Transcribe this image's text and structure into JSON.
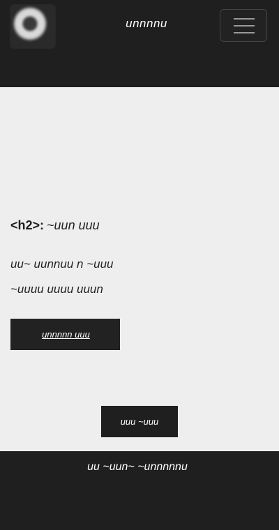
{
  "header": {
    "site_title": "unnnnu",
    "logo_icon": "circle-logo-icon",
    "menu_icon": "hamburger-icon"
  },
  "main": {
    "heading_tag": "<h2>:",
    "heading_text": "~uun uuu",
    "paragraph_line1": "uu~ uunnuu n ~uuu",
    "paragraph_line2": "~uuuu uuuu uuun",
    "cta_icon": "",
    "cta_label": "unnnnn uuu",
    "secondary_label": "uuu ~uuu"
  },
  "footer": {
    "text": "uu ~uun~ ~unnnnnu",
    "icon": ""
  },
  "colors": {
    "header_bg": "#1f1f1f",
    "content_bg": "#eeeeee",
    "button_bg": "#222222",
    "text_dark": "#222222",
    "text_light": "#ffffff"
  }
}
